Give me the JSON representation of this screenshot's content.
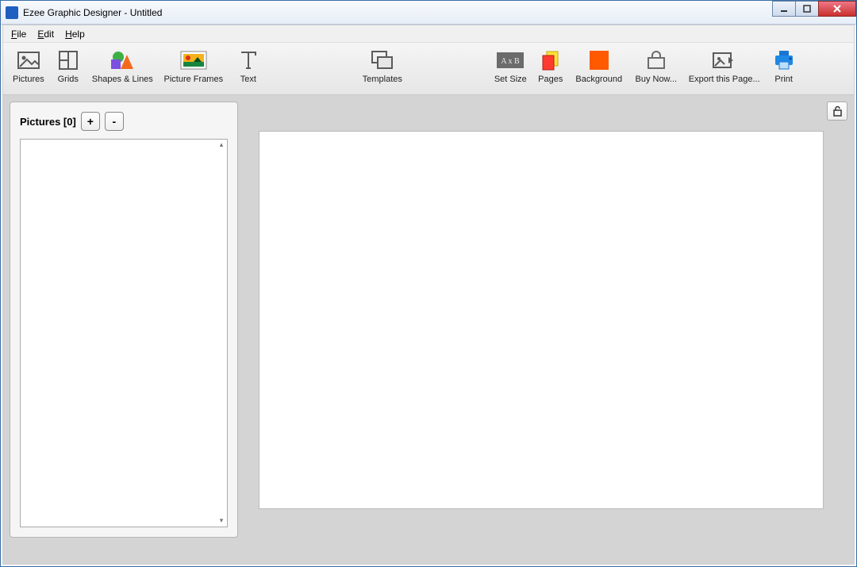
{
  "window": {
    "title": "Ezee Graphic Designer - Untitled"
  },
  "menus": {
    "file": "File",
    "edit": "Edit",
    "help": "Help"
  },
  "toolbar": {
    "pictures": "Pictures",
    "grids": "Grids",
    "shapes": "Shapes & Lines",
    "frames": "Picture Frames",
    "text": "Text",
    "templates": "Templates",
    "setsize": "Set Size",
    "pages": "Pages",
    "background": "Background",
    "buy": "Buy Now...",
    "export": "Export this Page...",
    "print": "Print"
  },
  "sidepanel": {
    "title": "Pictures [0]",
    "add": "+",
    "remove": "-"
  }
}
